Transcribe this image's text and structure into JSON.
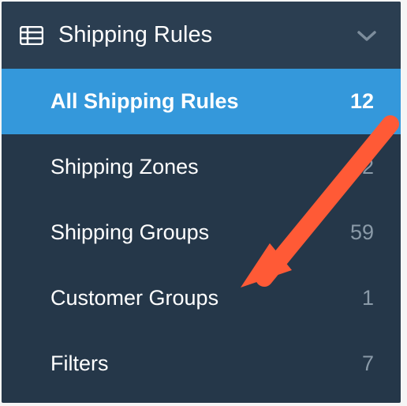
{
  "sidebar": {
    "title": "Shipping Rules",
    "items": [
      {
        "label": "All Shipping Rules",
        "count": "12",
        "active": true
      },
      {
        "label": "Shipping Zones",
        "count": "22",
        "active": false
      },
      {
        "label": "Shipping Groups",
        "count": "59",
        "active": false
      },
      {
        "label": "Customer Groups",
        "count": "1",
        "active": false
      },
      {
        "label": "Filters",
        "count": "7",
        "active": false
      }
    ]
  },
  "annotation": {
    "arrow_color": "#ff5a36"
  }
}
